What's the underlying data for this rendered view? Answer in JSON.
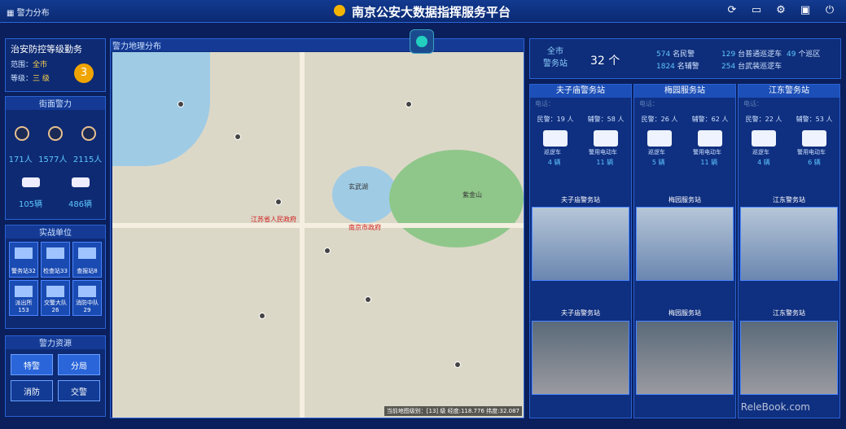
{
  "topbar": {
    "menu_icon": "grid-icon",
    "menu_label": "警力分布",
    "title": "南京公安大数据指挥服务平台",
    "icons": [
      "refresh-icon",
      "monitor-icon",
      "gear-icon",
      "display-icon",
      "power-icon"
    ]
  },
  "duty": {
    "title": "治安防控等级勤务",
    "scope_label": "范围：",
    "scope_value": "全市",
    "level_label": "等级：",
    "level_value": "三 级",
    "level_num": "3"
  },
  "street": {
    "title": "街面警力",
    "people": [
      "171人",
      "1577人",
      "2115人"
    ],
    "vehicles": [
      "105辆",
      "486辆"
    ]
  },
  "units": {
    "title": "实战单位",
    "items": [
      "警务站32",
      "检查站33",
      "查报站8",
      "派出所153",
      "交警大队26",
      "消防中队29"
    ]
  },
  "resources": {
    "title": "警力资源",
    "buttons": [
      "特警",
      "分局",
      "消防",
      "交警"
    ]
  },
  "map": {
    "title": "警力地理分布",
    "status": "当前地图级别：[13] 级  经度:118.776  纬度:32.087",
    "labels": {
      "government": "江苏省人民政府",
      "city": "南京市政府",
      "lake": "玄武湖",
      "mountain": "紫金山"
    }
  },
  "summary": {
    "scope": "全市",
    "type": "警务站",
    "count": "32 个",
    "police_value": "574",
    "police_label": "名民警",
    "aux_value": "1824",
    "aux_label": "名辅警",
    "patrol_value": "129",
    "patrol_label": "台普通巡逻车",
    "area_value": "49",
    "area_label": "个巡区",
    "armed_value": "254",
    "armed_label": "台武装巡逻车"
  },
  "stations": [
    {
      "name": "夫子庙警务站",
      "tel_label": "电话：",
      "police": "民警：19 人",
      "aux": "辅警：58 人",
      "car1": "巡逻车",
      "car2": "警用电动车",
      "c1": "4 辆",
      "c2": "11 辆",
      "photo1": "夫子庙警务站",
      "photo2": "夫子庙警务站"
    },
    {
      "name": "梅园服务站",
      "tel_label": "电话：",
      "police": "民警：26 人",
      "aux": "辅警：62 人",
      "car1": "巡逻车",
      "car2": "警用电动车",
      "c1": "5 辆",
      "c2": "11 辆",
      "photo1": "梅园服务站",
      "photo2": "梅园服务站"
    },
    {
      "name": "江东警务站",
      "tel_label": "电话：",
      "police": "民警：22 人",
      "aux": "辅警：53 人",
      "car1": "巡逻车",
      "car2": "警用电动车",
      "c1": "4 辆",
      "c2": "6 辆",
      "photo1": "江东警务站",
      "photo2": "江东警务站"
    }
  ],
  "watermark": "ReleBook.com"
}
